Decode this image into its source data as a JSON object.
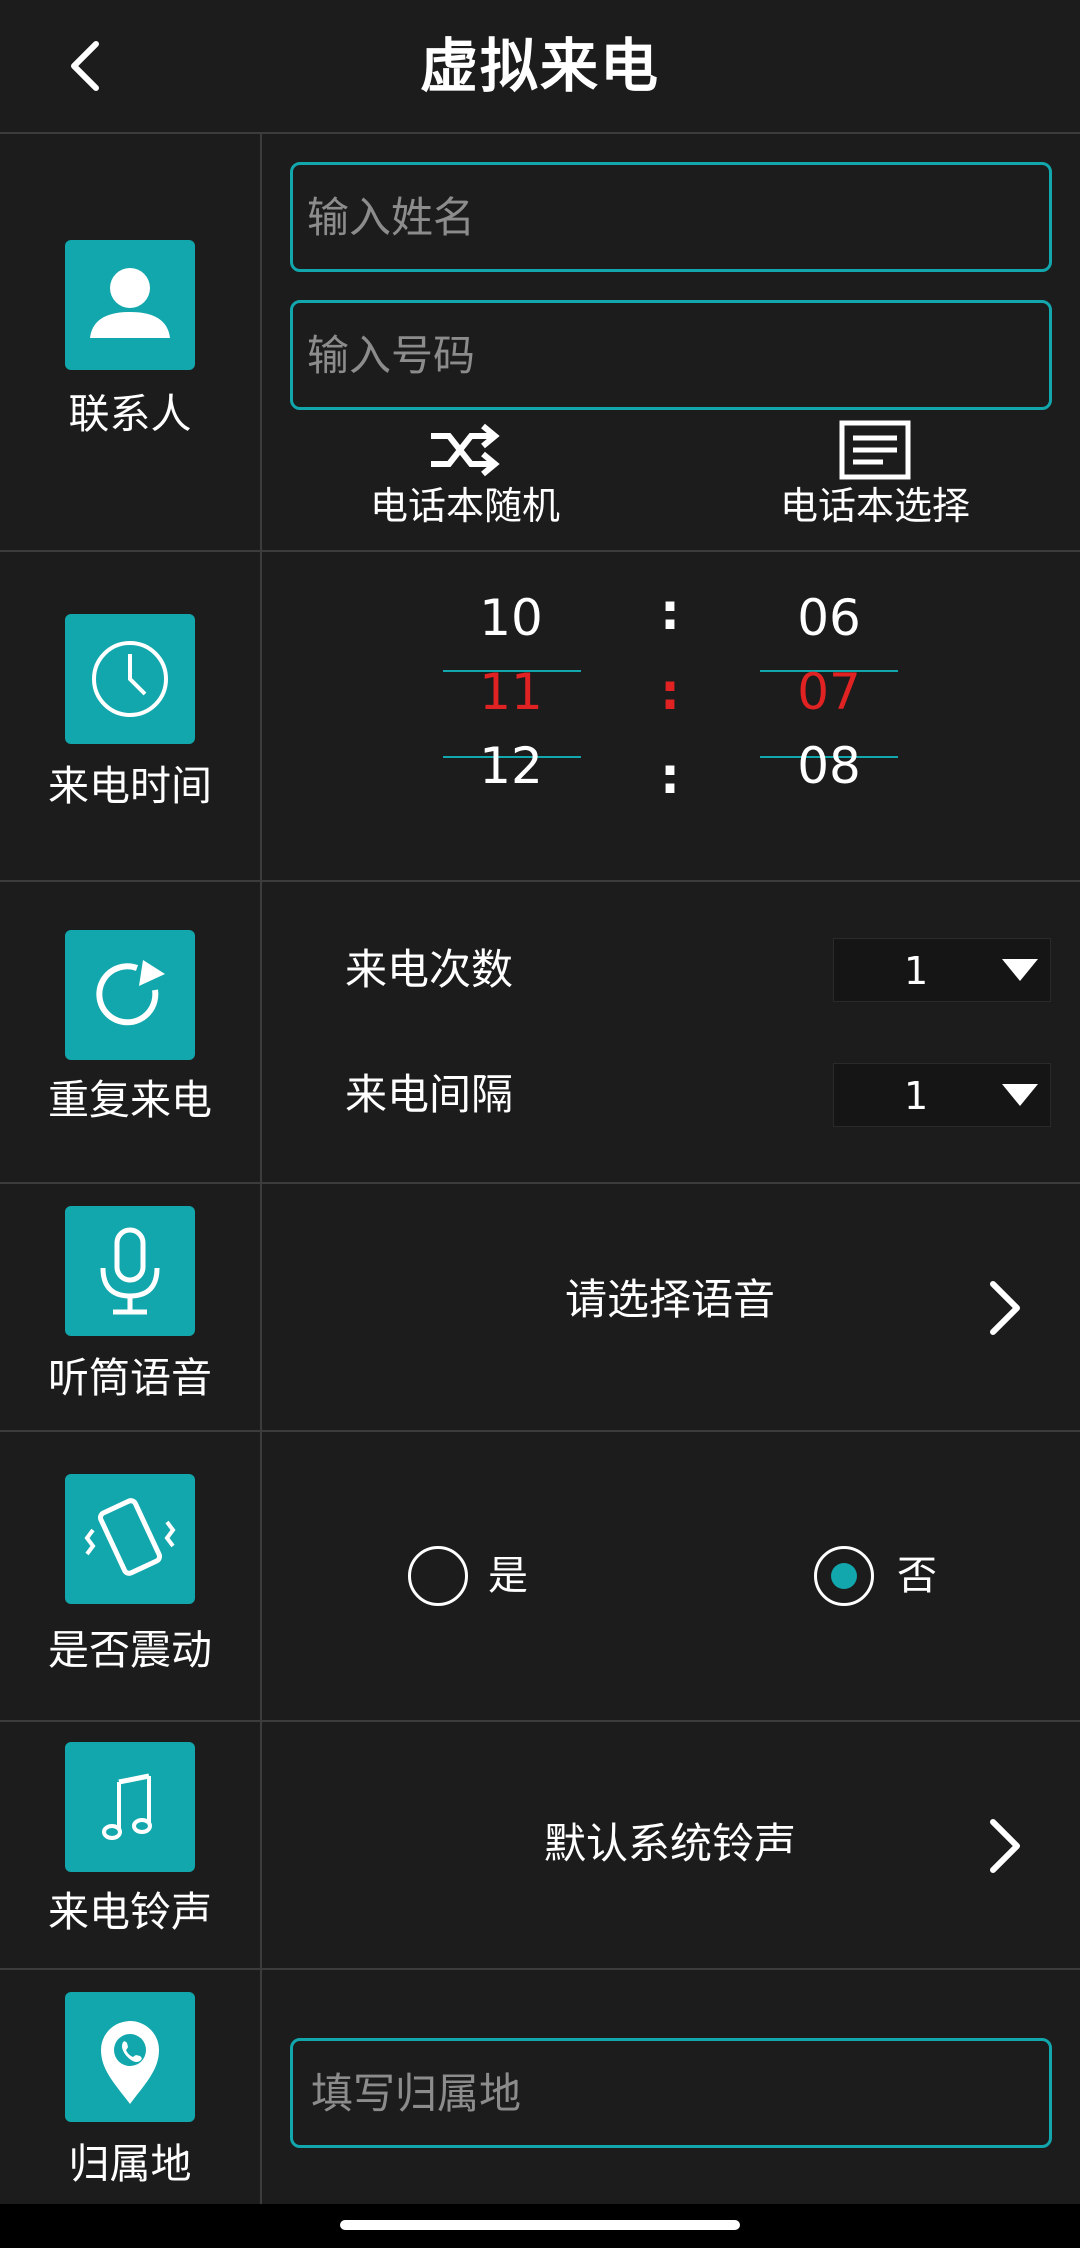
{
  "header": {
    "title": "虚拟来电"
  },
  "contact": {
    "label": "联系人",
    "name_placeholder": "输入姓名",
    "number_placeholder": "输入号码",
    "phonebook_random": "电话本随机",
    "phonebook_select": "电话本选择"
  },
  "time": {
    "label": "来电时间",
    "hours": [
      "10",
      "11",
      "12"
    ],
    "minutes": [
      "06",
      "07",
      "08"
    ],
    "separator": ":"
  },
  "repeat": {
    "label": "重复来电",
    "count_label": "来电次数",
    "count_value": "1",
    "interval_label": "来电间隔",
    "interval_value": "1"
  },
  "voice": {
    "label": "听筒语音",
    "value": "请选择语音"
  },
  "vibrate": {
    "label": "是否震动",
    "yes": "是",
    "no": "否",
    "selected": "否"
  },
  "ringtone": {
    "label": "来电铃声",
    "value": "默认系统铃声"
  },
  "location": {
    "label": "归属地",
    "placeholder": "填写归属地"
  },
  "colors": {
    "accent": "#12a7ac",
    "selected_time": "#e02222",
    "background": "#1c1c1c"
  }
}
